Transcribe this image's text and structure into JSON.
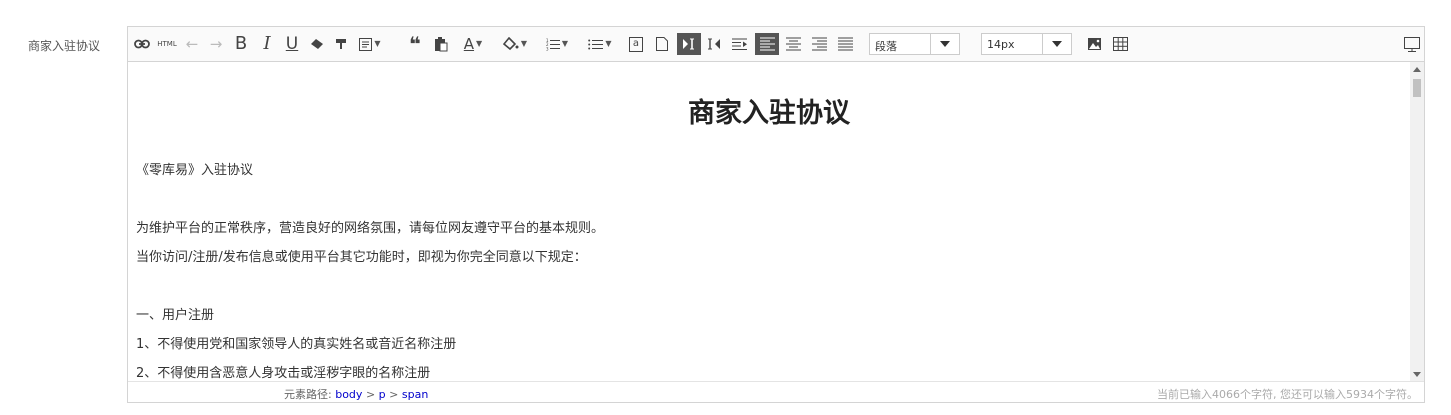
{
  "field": {
    "label": "商家入驻协议"
  },
  "toolbar": {
    "link_icon": "link-icon",
    "html_label": "HTML",
    "bold_label": "B",
    "italic_label": "I",
    "underline_label": "U",
    "quote_label": "❝",
    "font_color_label": "A",
    "clear_label": "a",
    "paragraph_select": {
      "value": "段落"
    },
    "fontsize_select": {
      "value": "14px"
    }
  },
  "document": {
    "title": "商家入驻协议",
    "paragraphs": [
      "《零库易》入驻协议",
      "为维护平台的正常秩序，营造良好的网络氛围，请每位网友遵守平台的基本规则。",
      "当你访问/注册/发布信息或使用平台其它功能时，即视为你完全同意以下规定：",
      "一、用户注册",
      "1、不得使用党和国家领导人的真实姓名或音近名称注册",
      "2、不得使用含恶意人身攻击或淫秽字眼的名称注册"
    ]
  },
  "status": {
    "path_label": "元素路径:",
    "path": [
      "body",
      "p",
      "span"
    ],
    "path_sep": ">",
    "count_text": "当前已输入4066个字符, 您还可以输入5934个字符。"
  },
  "colors": {
    "active_button": "#555555",
    "border": "#d4d4d4",
    "path_link": "#0000cc"
  }
}
